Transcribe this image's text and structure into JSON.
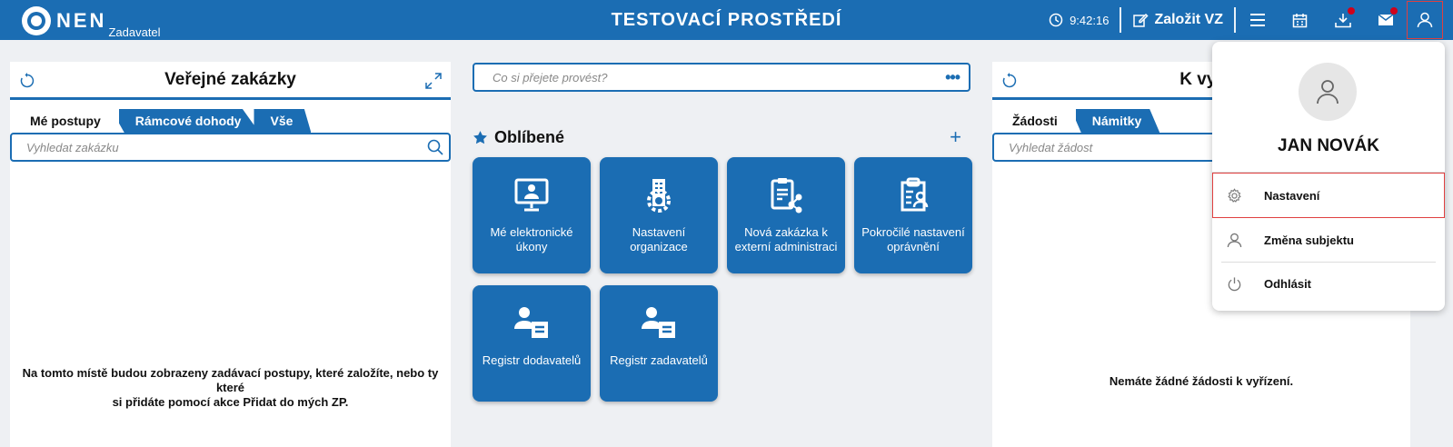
{
  "header": {
    "logo_text": "NEN",
    "logo_sub": "Zadavatel",
    "env_title": "TESTOVACÍ PROSTŘEDÍ",
    "clock": "9:42:16",
    "create_label": "Založit VZ",
    "icons": [
      "menu-icon",
      "calendar-icon",
      "download-icon",
      "mail-icon",
      "user-icon"
    ],
    "accent": "#1b6db3",
    "notification_color": "#d0021b"
  },
  "left_panel": {
    "title": "Veřejné zakázky",
    "tabs": [
      "Mé postupy",
      "Rámcové dohody",
      "Vše"
    ],
    "search_placeholder": "Vyhledat zakázku",
    "empty_message_line1": "Na tomto místě budou zobrazeny zadávací postupy, které založíte, nebo ty které",
    "empty_message_line2": "si přidáte pomocí akce Přidat do mých ZP."
  },
  "center": {
    "command_placeholder": "Co si přejete provést?",
    "command_more": "•••",
    "favorites_title": "Oblíbené",
    "add_label": "+",
    "tiles": [
      {
        "line1": "Mé elektronické",
        "line2": "úkony"
      },
      {
        "line1": "Nastavení",
        "line2": "organizace"
      },
      {
        "line1": "Nová zakázka k",
        "line2": "externí administraci"
      },
      {
        "line1": "Pokročilé nastavení",
        "line2": "oprávnění"
      },
      {
        "line1": "Registr dodavatelů",
        "line2": ""
      },
      {
        "line1": "Registr zadavatelů",
        "line2": ""
      }
    ]
  },
  "right_panel": {
    "title": "K vyř",
    "tabs": [
      "Žádosti",
      "Námitky"
    ],
    "search_placeholder": "Vyhledat žádost",
    "empty_message": "Nemáte žádné žádosti k vyřízení."
  },
  "user_menu": {
    "name": "JAN NOVÁK",
    "items": [
      "Nastavení",
      "Změna subjektu",
      "Odhlásit"
    ]
  }
}
